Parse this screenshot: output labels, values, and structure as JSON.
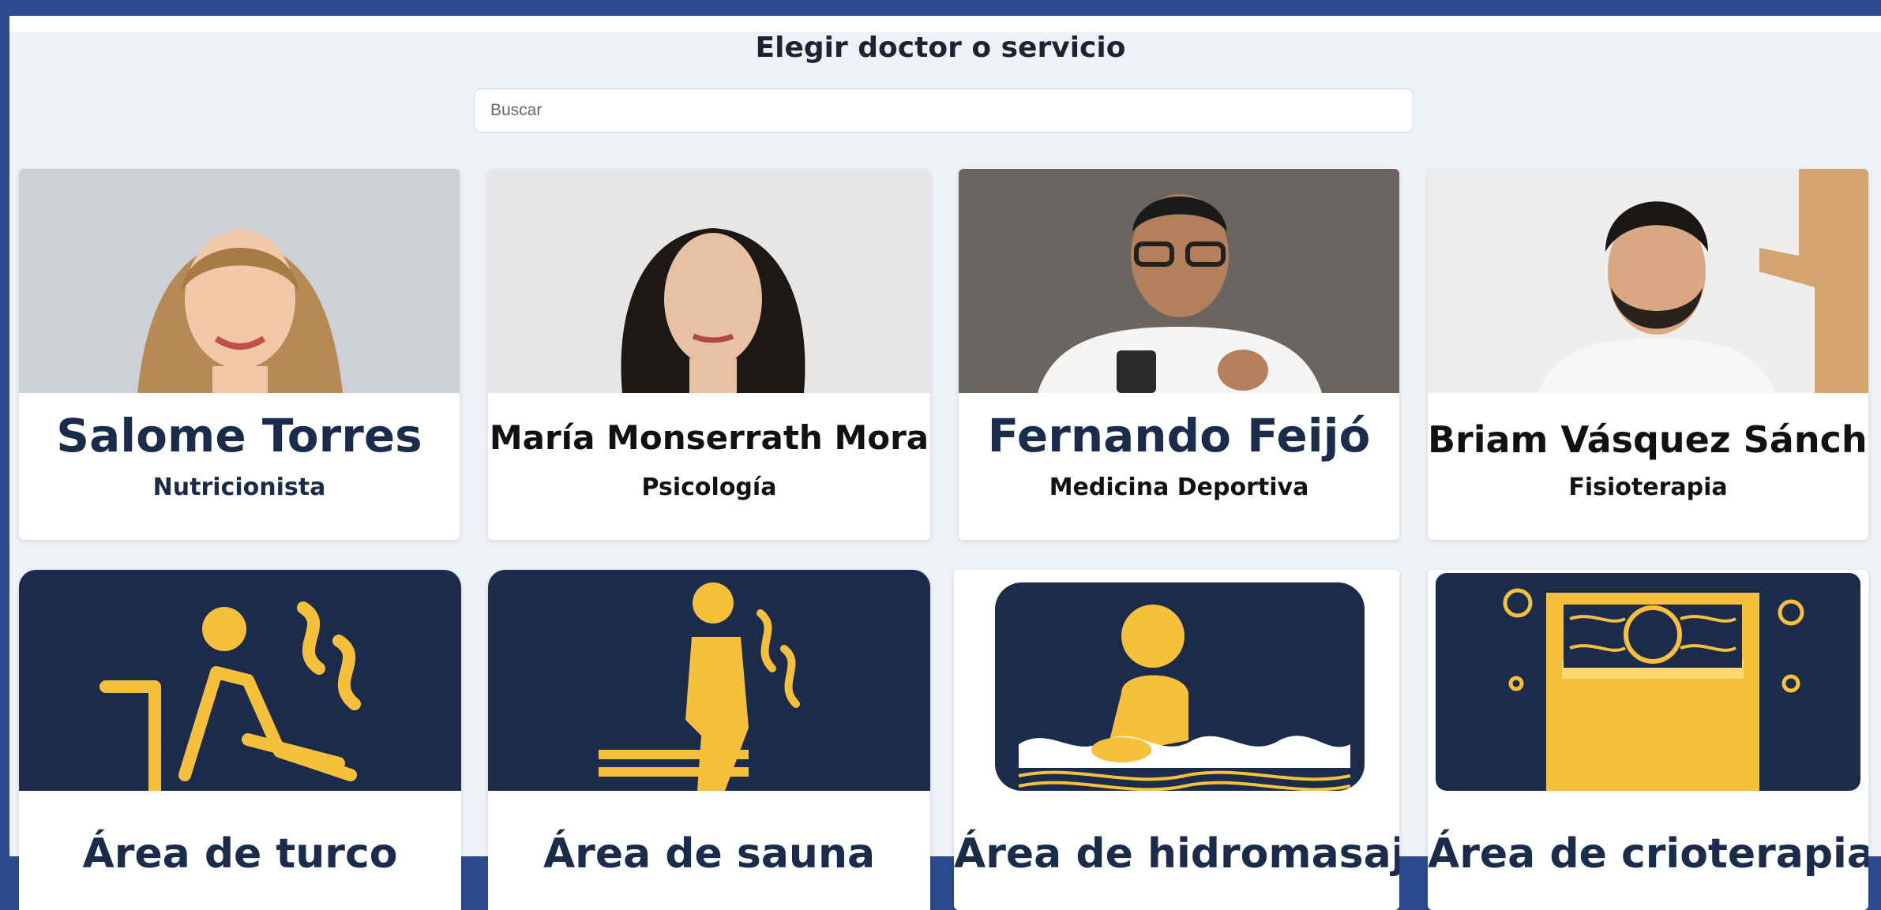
{
  "header": {
    "title": "Elegir doctor o servicio"
  },
  "search": {
    "placeholder": "Buscar"
  },
  "doctors": [
    {
      "name": "Salome Torres",
      "specialty": "Nutricionista"
    },
    {
      "name": "María Monserrath Mora",
      "specialty": "Psicología"
    },
    {
      "name": "Fernando Feijó",
      "specialty": "Medicina Deportiva"
    },
    {
      "name": "Briam Vásquez Sánchez",
      "specialty": "Fisioterapia"
    }
  ],
  "services": [
    {
      "label": "Área de turco",
      "icon": "steam-room-icon"
    },
    {
      "label": "Área de sauna",
      "icon": "sauna-icon"
    },
    {
      "label": "Área de hidromasaje",
      "icon": "hydromassage-icon"
    },
    {
      "label": "Área de crioterapia",
      "icon": "cryotherapy-icon"
    }
  ],
  "colors": {
    "navy": "#1a2b4c",
    "gold": "#f6c03b",
    "page_bg": "#2b4b8e"
  }
}
